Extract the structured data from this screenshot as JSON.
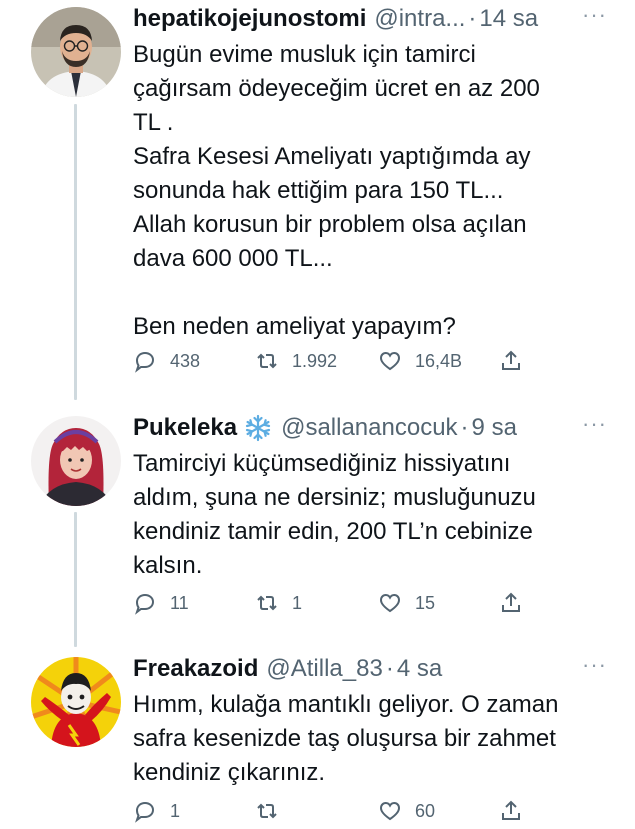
{
  "tweets": [
    {
      "name": "hepatikojejunostomi",
      "handle": "@intra...",
      "dot": "·",
      "time": "14 sa",
      "more": "···",
      "text": "Bugün evime musluk için tamirci\nçağırsam ödeyeceğim ücret en az 200\nTL .\nSafra Kesesi Ameliyatı yaptığımda ay\nsonunda hak ettiğim para 150 TL...\nAllah korusun bir problem olsa açılan\ndava 600 000 TL...\n\nBen neden ameliyat yapayım?",
      "replies": "438",
      "retweets": "1.992",
      "likes": "16,4B"
    },
    {
      "name": "Pukeleka",
      "handle": "@sallanancocuk",
      "dot": "·",
      "time": "9 sa",
      "more": "···",
      "text": "Tamirciyi küçümsediğiniz hissiyatını\naldım, şuna ne dersiniz; musluğunuzu\nkendiniz tamir edin, 200 TL’n cebinize\nkalsın.",
      "replies": "11",
      "retweets": "1",
      "likes": "15"
    },
    {
      "name": "Freakazoid",
      "handle": "@Atilla_83",
      "dot": "·",
      "time": "4 sa",
      "more": "···",
      "text": "Hımm, kulağa mantıklı geliyor. O zaman\nsafra kesenizde taş oluşursa bir zahmet\nkendiniz çıkarınız.",
      "replies": "1",
      "retweets": "",
      "likes": "60"
    }
  ],
  "colors": {
    "text": "#0f1419",
    "secondary": "#536471",
    "thread_line": "#cfd9de",
    "snowflake": "#5dade2"
  },
  "icons": {
    "reply": "reply-icon",
    "retweet": "retweet-icon",
    "like": "heart-icon",
    "share": "share-icon",
    "badge": "snowflake-icon"
  }
}
